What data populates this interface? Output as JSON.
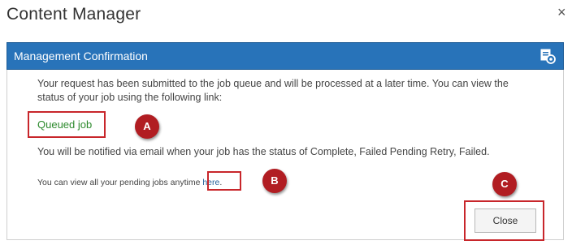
{
  "dialog": {
    "title": "Content Manager",
    "close_glyph": "×"
  },
  "header": {
    "title": "Management Confirmation",
    "icon": "management-icon",
    "background_color": "#2873b9"
  },
  "content": {
    "paragraph_1": "Your request has been submitted to the job queue and will be processed at a later time. You can view the status of your job using the following link:",
    "queued_job_link": "Queued job",
    "paragraph_2": "You will be notified via email when your job has the status of Complete, Failed Pending Retry, Failed.",
    "paragraph_3_prefix": "You can view all your pending jobs anytime ",
    "here_link": "here",
    "paragraph_3_suffix": "."
  },
  "annotations": {
    "badge_a": "A",
    "badge_b": "B",
    "badge_c": "C",
    "highlight_color": "#c8262b",
    "badge_color": "#b11d22"
  },
  "buttons": {
    "close_label": "Close"
  }
}
